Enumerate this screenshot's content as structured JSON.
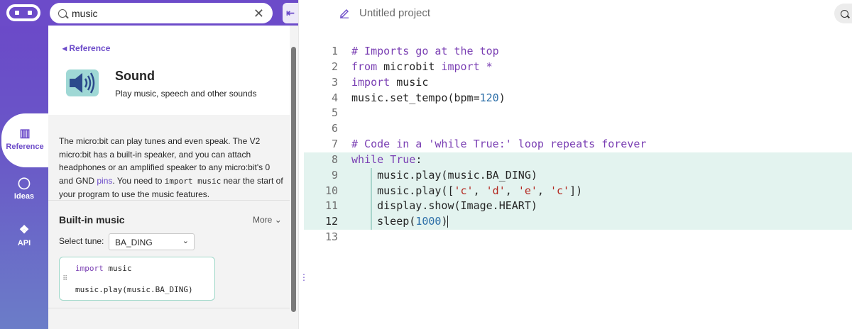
{
  "search": {
    "value": "music"
  },
  "rail": {
    "tabs": [
      {
        "label": "Reference",
        "icon": "books-icon"
      },
      {
        "label": "Ideas",
        "icon": "lightbulb-icon"
      },
      {
        "label": "API",
        "icon": "python-icon"
      }
    ]
  },
  "reference": {
    "back_label": "Reference",
    "title": "Sound",
    "subtitle": "Play music, speech and other sounds",
    "description": {
      "part1": "The micro:bit can play tunes and even speak. The V2 micro:bit has a built-in speaker, and you can attach headphones or an amplified speaker to any micro:bit's 0 and GND ",
      "link": "pins",
      "part2": ". You need to ",
      "code": "import music",
      "part3": " near the start of your program to use the music features."
    },
    "section_title": "Built-in music",
    "more_label": "More",
    "select_label": "Select tune:",
    "select_value": "BA_DING",
    "snippet": {
      "line1_kw": "import",
      "line1_rest": " music",
      "line2": "music.play(music.BA_DING)"
    }
  },
  "editor": {
    "project_name": "Untitled project",
    "current_line": 12,
    "lines": [
      {
        "n": "1",
        "text": "# Imports go at the top"
      },
      {
        "n": "2",
        "text": "from microbit import *"
      },
      {
        "n": "3",
        "text": "import music"
      },
      {
        "n": "4",
        "text": "music.set_tempo(bpm=120)"
      },
      {
        "n": "5",
        "text": ""
      },
      {
        "n": "6",
        "text": ""
      },
      {
        "n": "7",
        "text": "# Code in a 'while True:' loop repeats forever"
      },
      {
        "n": "8",
        "text": "while True:"
      },
      {
        "n": "9",
        "text": "    music.play(music.BA_DING)"
      },
      {
        "n": "10",
        "text": "    music.play(['c', 'd', 'e', 'c'])"
      },
      {
        "n": "11",
        "text": "    display.show(Image.HEART)"
      },
      {
        "n": "12",
        "text": "    sleep(1000)"
      },
      {
        "n": "13",
        "text": ""
      }
    ]
  },
  "colors": {
    "accent": "#6c4bc9",
    "highlight": "#e3f3ef",
    "keyword": "#7a3fb3",
    "number": "#2d6fa8",
    "string": "#b3261e"
  }
}
